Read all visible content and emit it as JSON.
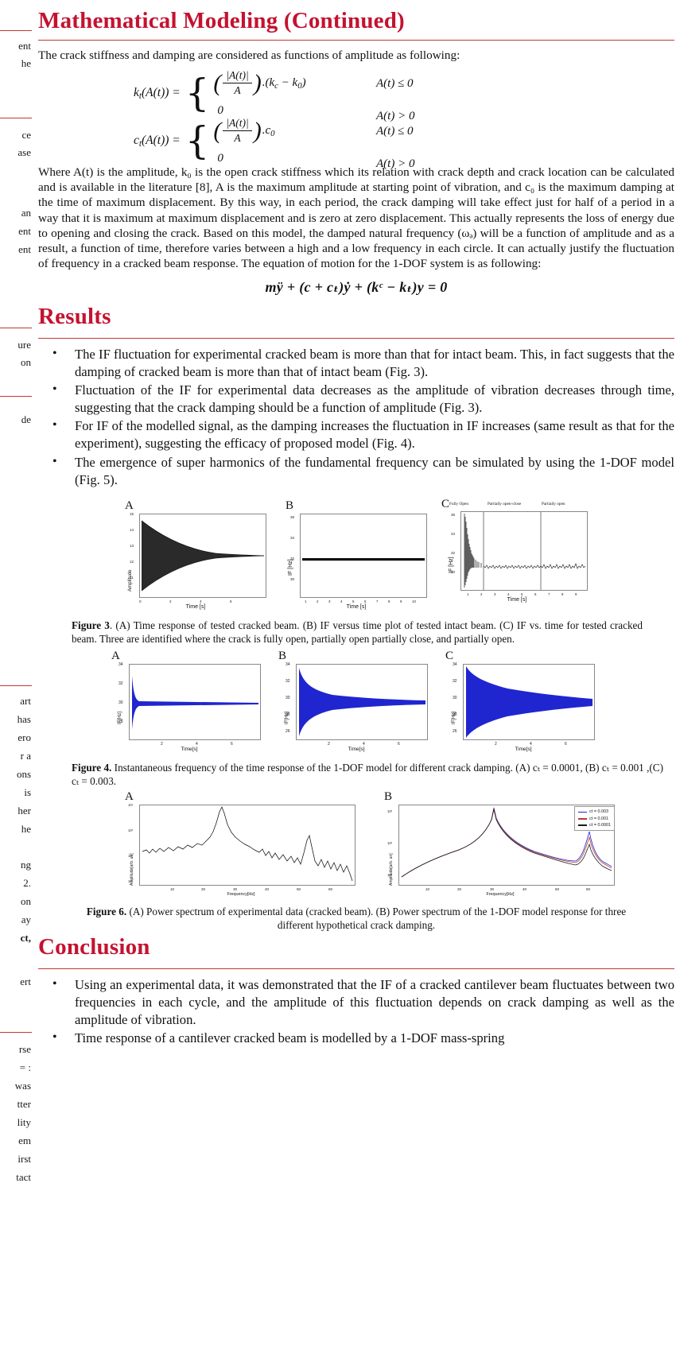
{
  "colors": {
    "heading_red": "#c41230",
    "rule_red": "#c0392b",
    "blue": "#1f26d0",
    "magenta": "#c0392b"
  },
  "left_column_fragments": [
    "ent",
    "he",
    "ce",
    "ase",
    "an",
    "ent",
    "ent",
    "ure",
    "on",
    "de",
    "art",
    "has",
    "ero",
    "r a",
    "ons",
    "is",
    "her",
    "he",
    "ng",
    "2.",
    "on",
    "ay",
    "ct,",
    "ert",
    "rse",
    "= :",
    "was",
    "tter",
    "lity",
    "em",
    "irst",
    "tact"
  ],
  "sections": {
    "math_modeling": {
      "title": "Mathematical Modeling (Continued)",
      "intro": "The crack stiffness and damping are considered as functions of amplitude as following:",
      "equations": {
        "kt": {
          "lhs": "k",
          "lhs_sub": "t",
          "lhs_rest": "(A(t)) =",
          "num": "|A(t)|",
          "den": "A",
          "factor": ".(k",
          "factor_sub1": "c",
          "factor_mid": " − k",
          "factor_sub2": "0",
          "factor_end": ")",
          "zero": "0",
          "cond1": "A(t) ≤ 0",
          "cond2": "A(t) > 0"
        },
        "ct": {
          "lhs": "c",
          "lhs_sub": "t",
          "lhs_rest": "(A(t)) =",
          "num": "|A(t)|",
          "den": "A",
          "factor": ".c",
          "factor_sub1": "0",
          "zero": "0",
          "cond1": "A(t) ≤ 0",
          "cond2": "A(t) > 0"
        }
      },
      "paragraph": "Where A(t) is the amplitude, k₀ is the open crack stiffness which its relation with crack depth and crack location can be calculated and is available in the literature [8], A is the maximum amplitude at starting point of vibration, and c₀ is the maximum damping at the time of maximum displacement. By this way, in each period, the crack damping will take effect just for half of a period in a way that it is maximum at maximum displacement and is zero at zero displacement. This actually represents the loss of energy due to opening and closing the crack. Based on this model, the damped natural frequency (ωₔ) will be a function of amplitude and as a result, a function of time, therefore varies between a high and a low frequency in each circle. It can actually justify the fluctuation of frequency in a cracked beam response. The equation of motion for the 1-DOF system is as following:",
      "equation_of_motion": "mÿ + (c + cₜ)ẏ + (kᶜ − kₜ)y = 0"
    },
    "results": {
      "title": "Results",
      "bullets": [
        "The IF fluctuation for experimental cracked beam is more than that for intact beam. This, in fact suggests that the damping of cracked beam is more than that of intact beam (Fig. 3).",
        "Fluctuation of the IF for experimental data decreases as the amplitude of vibration decreases through time, suggesting that the crack damping should be a function of amplitude (Fig. 3).",
        "For IF of  the modelled signal, as the damping increases the fluctuation in IF increases (same result as that for the experiment), suggesting the efficacy of proposed model (Fig. 4).",
        "The emergence of super harmonics of the fundamental frequency can be simulated by using the 1-DOF model (Fig. 5)."
      ]
    },
    "conclusion": {
      "title": "Conclusion",
      "bullets": [
        "Using an experimental data, it was demonstrated that the IF of a cracked cantilever beam fluctuates between two frequencies in each cycle, and the amplitude of this fluctuation depends on crack damping as well as the amplitude of vibration.",
        "Time response of a cantilever cracked beam is modelled by a 1-DOF mass-spring"
      ]
    }
  },
  "figures": {
    "fig3": {
      "caption_label": "Figure 3",
      "caption_text": ". (A) Time response of tested cracked beam. (B) IF versus time plot of tested intact beam. (C) IF vs. time for tested cracked beam. Three are identified where the crack is fully open, partially open partially close, and partially open.",
      "panels": [
        {
          "label": "A",
          "ylabel": "Amplitude",
          "xlabel": "Time [s]",
          "yticks": [
            "15",
            "14",
            "13",
            "12",
            "11",
            "0"
          ],
          "xticks": [
            "0",
            "2",
            "4",
            "6",
            "8"
          ]
        },
        {
          "label": "B",
          "ylabel": "IF [Hz]",
          "xlabel": "Time [s]",
          "yticks": [
            "36",
            "34",
            "32",
            "30",
            "28"
          ],
          "xticks": [
            "1",
            "2",
            "3",
            "4",
            "5",
            "6",
            "7",
            "8",
            "9",
            "10"
          ]
        },
        {
          "label": "C",
          "ylabel": "IF [Hz]",
          "xlabel": "Time [s]",
          "yticks": [
            "36",
            "34",
            "32",
            "30",
            "28"
          ],
          "xticks": [
            "1",
            "2",
            "3",
            "4",
            "5",
            "6",
            "7",
            "8",
            "9"
          ],
          "annotations": [
            "Fully Open",
            "Partially open-close",
            "Partially open"
          ]
        }
      ]
    },
    "fig4": {
      "caption_label": "Figure 4.",
      "caption_text": " Instantaneous frequency of the time response of the 1-DOF model for different crack damping. (A) cₜ = 0.0001, (B) cₜ = 0.001 ,(C) cₜ = 0.003.",
      "panels": [
        {
          "label": "A",
          "ylabel": "IF[Hz]",
          "xlabel": "Time[s]",
          "yticks": [
            "34",
            "32",
            "30",
            "28"
          ],
          "xticks": [
            "2",
            "4",
            "6"
          ]
        },
        {
          "label": "B",
          "ylabel": "IF[Hz]",
          "xlabel": "Time[s]",
          "yticks": [
            "34",
            "32",
            "30",
            "28",
            "26"
          ],
          "xticks": [
            "2",
            "4",
            "6"
          ]
        },
        {
          "label": "C",
          "ylabel": "IF[Hz]",
          "xlabel": "Time[s]",
          "yticks": [
            "34",
            "32",
            "30",
            "28",
            "26"
          ],
          "xticks": [
            "2",
            "4",
            "6"
          ]
        }
      ]
    },
    "fig6": {
      "caption_label": "Figure 6.",
      "caption_text": " (A) Power spectrum of experimental data (cracked beam). (B) Power spectrum of the 1-DOF model response for three different hypothetical crack damping.",
      "panels": [
        {
          "label": "A",
          "ylabel": "Amplitude[arb. un]",
          "xlabel": "Frequency[Hz]",
          "yticks": [
            "10⁴",
            "10³",
            "10²",
            "10¹"
          ],
          "xticks": [
            "10",
            "20",
            "30",
            "40",
            "50",
            "60"
          ]
        },
        {
          "label": "B",
          "ylabel": "Amplitude[arb. un]",
          "xlabel": "Frequency[Hz]",
          "yticks": [
            "10³",
            "10²",
            "10¹"
          ],
          "xticks": [
            "10",
            "20",
            "30",
            "40",
            "50",
            "60"
          ],
          "legend": [
            {
              "label": "ct = 0.003",
              "color": "#1f26d0"
            },
            {
              "label": "ct = 0.001",
              "color": "#c0392b"
            },
            {
              "label": "ct = 0.0001",
              "color": "#1a1a1a"
            }
          ]
        }
      ]
    }
  },
  "chart_data": [
    {
      "type": "line",
      "title": "Figure 3A — Time response of tested cracked beam",
      "xlabel": "Time [s]",
      "ylabel": "Amplitude",
      "xlim": [
        0,
        9
      ],
      "ylim": [
        -15,
        15
      ],
      "description": "Exponentially decaying oscillation envelope, amplitude ~15 at t=0 decaying to near 0 by t=9",
      "envelope_x": [
        0,
        1,
        2,
        3,
        4,
        5,
        6,
        7,
        8,
        9
      ],
      "envelope_y": [
        14.5,
        9.5,
        6.3,
        4.2,
        2.8,
        1.9,
        1.3,
        0.9,
        0.6,
        0.4
      ]
    },
    {
      "type": "line",
      "title": "Figure 3B — IF versus time, tested intact beam",
      "xlabel": "Time [s]",
      "ylabel": "IF [Hz]",
      "xlim": [
        0,
        10
      ],
      "ylim": [
        28,
        37
      ],
      "x": [
        0,
        1,
        2,
        3,
        4,
        5,
        6,
        7,
        8,
        9,
        10
      ],
      "y": [
        30.2,
        30.1,
        30.1,
        30.1,
        30.1,
        30.1,
        30.1,
        30.1,
        30.1,
        30.1,
        30.1
      ]
    },
    {
      "type": "line",
      "title": "Figure 3C — IF vs time, tested cracked beam",
      "xlabel": "Time [s]",
      "ylabel": "IF [Hz]",
      "xlim": [
        0,
        9
      ],
      "ylim": [
        28,
        37
      ],
      "regions": [
        {
          "name": "Fully Open",
          "x_range": [
            0,
            1.6
          ]
        },
        {
          "name": "Partially open-close",
          "x_range": [
            1.6,
            5.6
          ]
        },
        {
          "name": "Partially open",
          "x_range": [
            5.6,
            9
          ]
        }
      ],
      "x": [
        0,
        0.5,
        1,
        1.6,
        3,
        5,
        5.6,
        7,
        9
      ],
      "y": [
        35.5,
        32.5,
        31.0,
        30.3,
        30.1,
        30.1,
        30.1,
        30.1,
        30.1
      ]
    },
    {
      "type": "line",
      "title": "Figure 4A — IF, 1-DOF model, ct = 0.0001",
      "xlabel": "Time[s]",
      "ylabel": "IF[Hz]",
      "xlim": [
        0,
        7
      ],
      "ylim": [
        26,
        34
      ],
      "series": [
        {
          "name": "IF envelope upper",
          "x": [
            0,
            0.3,
            1,
            2,
            3,
            4,
            5,
            6,
            7
          ],
          "values": [
            32.0,
            30.3,
            29.9,
            29.8,
            29.7,
            29.7,
            29.6,
            29.6,
            29.6
          ]
        },
        {
          "name": "IF envelope lower",
          "x": [
            0,
            0.3,
            1,
            2,
            3,
            4,
            5,
            6,
            7
          ],
          "values": [
            27.8,
            29.3,
            29.5,
            29.5,
            29.5,
            29.5,
            29.5,
            29.5,
            29.5
          ]
        }
      ]
    },
    {
      "type": "line",
      "title": "Figure 4B — IF, 1-DOF model, ct = 0.001",
      "xlabel": "Time[s]",
      "ylabel": "IF[Hz]",
      "xlim": [
        0,
        7
      ],
      "ylim": [
        26,
        34
      ],
      "series": [
        {
          "name": "IF envelope upper",
          "x": [
            0,
            0.3,
            1,
            2,
            3,
            4,
            5,
            6,
            7
          ],
          "values": [
            33.5,
            31.6,
            31.0,
            30.6,
            30.4,
            30.2,
            30.1,
            30.0,
            30.0
          ]
        },
        {
          "name": "IF envelope lower",
          "x": [
            0,
            0.3,
            1,
            2,
            3,
            4,
            5,
            6,
            7
          ],
          "values": [
            26.3,
            28.4,
            28.9,
            29.3,
            29.5,
            29.6,
            29.7,
            29.8,
            29.8
          ]
        }
      ]
    },
    {
      "type": "line",
      "title": "Figure 4C — IF, 1-DOF model, ct = 0.003",
      "xlabel": "Time[s]",
      "ylabel": "IF[Hz]",
      "xlim": [
        0,
        7
      ],
      "ylim": [
        26,
        34
      ],
      "series": [
        {
          "name": "IF envelope upper",
          "x": [
            0,
            0.3,
            1,
            2,
            3,
            4,
            5,
            6,
            7
          ],
          "values": [
            34.0,
            32.6,
            32.0,
            31.4,
            31.0,
            30.7,
            30.5,
            30.3,
            30.2
          ]
        },
        {
          "name": "IF envelope lower",
          "x": [
            0,
            0.3,
            1,
            2,
            3,
            4,
            5,
            6,
            7
          ],
          "values": [
            26.0,
            27.4,
            27.9,
            28.4,
            28.8,
            29.1,
            29.3,
            29.5,
            29.6
          ]
        }
      ]
    },
    {
      "type": "line",
      "title": "Figure 6A — Power spectrum of experimental data (cracked beam)",
      "xlabel": "Frequency[Hz]",
      "ylabel": "Amplitude[arb. un]",
      "xlim": [
        0,
        68
      ],
      "ylim_log": [
        1,
        10000
      ],
      "peaks": [
        {
          "frequency": 28.5,
          "note": "fundamental"
        },
        {
          "frequency": 56.5,
          "note": "second harmonic"
        }
      ],
      "x": [
        1,
        5,
        10,
        15,
        20,
        24,
        27,
        28.5,
        30,
        33,
        38,
        44,
        50,
        56.5,
        60,
        66
      ],
      "y": [
        60,
        55,
        50,
        58,
        75,
        160,
        900,
        6000,
        1100,
        300,
        110,
        45,
        22,
        300,
        18,
        6
      ]
    },
    {
      "type": "line",
      "title": "Figure 6B — Power spectrum of 1-DOF model response, three crack dampings",
      "xlabel": "Frequency[Hz]",
      "ylabel": "Amplitude[arb. un]",
      "xlim": [
        5,
        68
      ],
      "ylim_log": [
        1,
        10000
      ],
      "legend_position": "top-right",
      "series": [
        {
          "name": "ct = 0.003",
          "color": "#1f26d0",
          "x": [
            6,
            10,
            20,
            29.8,
            40,
            50,
            59.5,
            66
          ],
          "values": [
            4,
            9,
            55,
            6000,
            70,
            22,
            95,
            13
          ]
        },
        {
          "name": "ct = 0.001",
          "color": "#c0392b",
          "x": [
            6,
            10,
            20,
            29.8,
            40,
            50,
            59.5,
            66
          ],
          "values": [
            4,
            9,
            55,
            6000,
            70,
            21,
            60,
            11
          ]
        },
        {
          "name": "ct = 0.0001",
          "color": "#1a1a1a",
          "x": [
            6,
            10,
            20,
            29.8,
            40,
            50,
            59.5,
            66
          ],
          "values": [
            4,
            9,
            55,
            6000,
            68,
            20,
            35,
            10
          ]
        }
      ]
    }
  ]
}
